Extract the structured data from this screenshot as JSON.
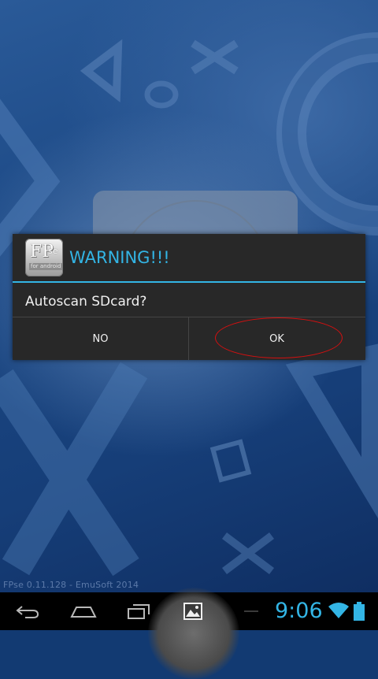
{
  "app": {
    "version_text": "FPse 0.11.128 - EmuSoft 2014"
  },
  "dialog": {
    "icon": {
      "main": "FP",
      "superscript": "se",
      "subtitle": "for android",
      "name": "fpse-app-icon"
    },
    "title": "WARNING!!!",
    "message": "Autoscan SDcard?",
    "buttons": {
      "no": "NO",
      "ok": "OK"
    },
    "highlight": "ok-button-red-circle"
  },
  "navbar": {
    "buttons": [
      "back-icon",
      "home-icon",
      "recent-apps-icon",
      "gallery-icon"
    ]
  },
  "status": {
    "time": "9:06",
    "wifi": "wifi-icon",
    "battery": "battery-icon"
  },
  "colors": {
    "accent": "#33b5e5",
    "dialog_bg": "#282828",
    "highlight_red": "#d41010"
  }
}
